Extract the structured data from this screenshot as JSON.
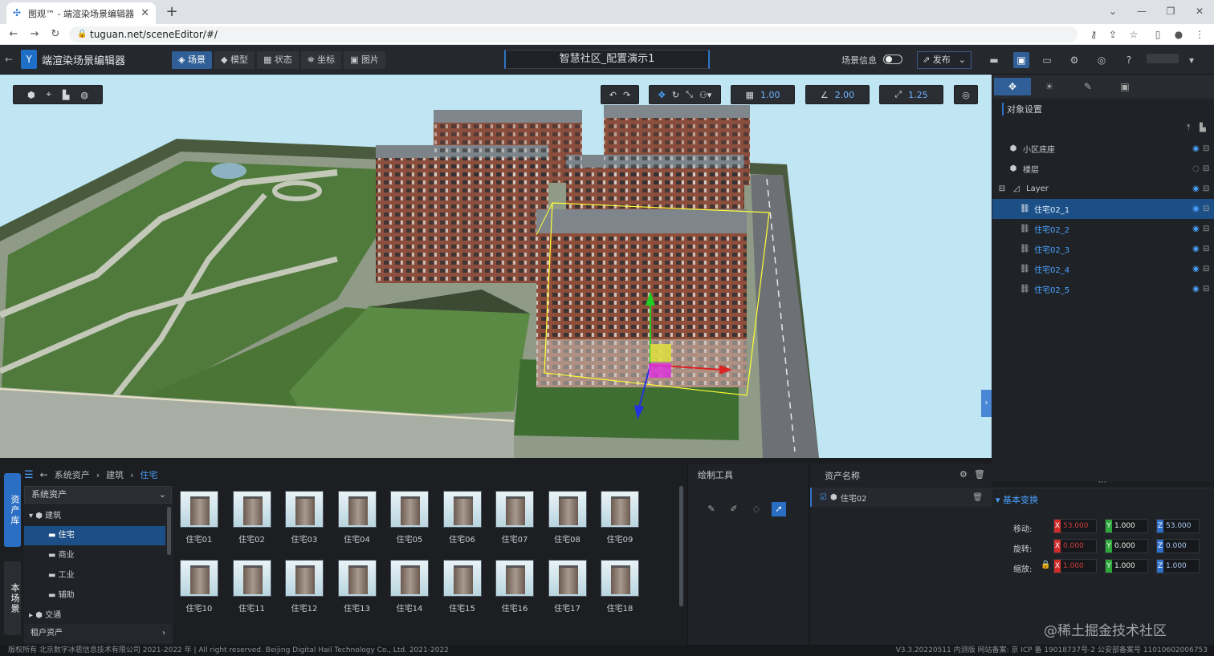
{
  "browser": {
    "tab_title": "图观™ - 端渲染场景编辑器",
    "url": "tuguan.net/sceneEditor/#/"
  },
  "app": {
    "title": "端渲染场景编辑器",
    "menu": [
      "场景",
      "模型",
      "状态",
      "坐标",
      "图片"
    ],
    "scene_name": "智慧社区_配置演示1",
    "scene_info_label": "场景信息",
    "publish_label": "发布"
  },
  "viewport_toolbar": {
    "grid_value": "1.00",
    "angle_value": "2.00",
    "scale_value": "1.25"
  },
  "right_panel": {
    "section_title": "对象设置",
    "tree": [
      {
        "label": "小区底座"
      },
      {
        "label": "楼层"
      },
      {
        "label": "Layer"
      },
      {
        "label": "住宅02_1",
        "selected": true
      },
      {
        "label": "住宅02_2"
      },
      {
        "label": "住宅02_3"
      },
      {
        "label": "住宅02_4"
      },
      {
        "label": "住宅02_5"
      }
    ]
  },
  "transform": {
    "title": "基本变换",
    "rows": [
      {
        "label": "移动:",
        "x": "53.000",
        "y": "1.000",
        "z": "53.000"
      },
      {
        "label": "旋转:",
        "x": "0.000",
        "y": "0.000",
        "z": "0.000"
      },
      {
        "label": "缩放:",
        "x": "1.000",
        "y": "1.000",
        "z": "1.000"
      }
    ]
  },
  "assets": {
    "side_tabs": [
      "资产库",
      "本场景"
    ],
    "breadcrumb": [
      "系统资产",
      "建筑",
      "住宅"
    ],
    "selector": "系统资产",
    "tree": [
      "建筑",
      "住宅",
      "商业",
      "工业",
      "辅助",
      "交通",
      "租户资产"
    ],
    "items": [
      "住宅01",
      "住宅02",
      "住宅03",
      "住宅04",
      "住宅05",
      "住宅06",
      "住宅07",
      "住宅08",
      "住宅09",
      "住宅10",
      "住宅11",
      "住宅12",
      "住宅13",
      "住宅14",
      "住宅15",
      "住宅16",
      "住宅17",
      "住宅18"
    ]
  },
  "draw_tools": {
    "title": "绘制工具"
  },
  "asset_panel": {
    "title": "资产名称",
    "item": "住宅02"
  },
  "footer": {
    "left": "版权所有 北京数字冰雹信息技术有限公司 2021-2022 年 | All right reserved. Beijing Digital Hail Technology Co., Ltd. 2021-2022",
    "right": "V3.3.20220511 内测版 网站备案: 京 ICP 备 19018737号-2 公安部备案号 11010602006753"
  },
  "watermark": "@稀土掘金技术社区"
}
